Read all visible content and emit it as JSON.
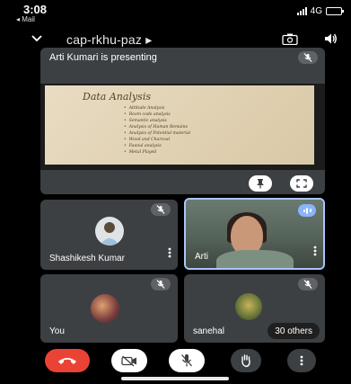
{
  "status_bar": {
    "time": "3:08",
    "back_label": "◂ Mail",
    "network": "4G",
    "battery_level": 0.85
  },
  "header": {
    "meeting_code": "cap-rkhu-paz ▸"
  },
  "presentation": {
    "title": "Arti Kumari is presenting",
    "slide": {
      "title": "Data Analysis",
      "items": [
        "Attitude Analysis",
        "Room code analysis",
        "Semantic analysis",
        "Analysis of Human Remains",
        "Analysis of Potential material",
        "Wood and Charcoal",
        "Faunal analysis",
        "Metal Played"
      ]
    }
  },
  "participants": [
    {
      "name": "Shashikesh Kumar",
      "muted": true
    },
    {
      "name": "Arti",
      "speaking": true
    },
    {
      "name": "You",
      "muted": true
    },
    {
      "name": "sanehal",
      "muted": true
    }
  ],
  "others_label": "30 others",
  "colors": {
    "end_call": "#ea4335",
    "tile": "#3c4043",
    "active_border": "#a8c7fa",
    "speaking": "#8ab4f8"
  }
}
